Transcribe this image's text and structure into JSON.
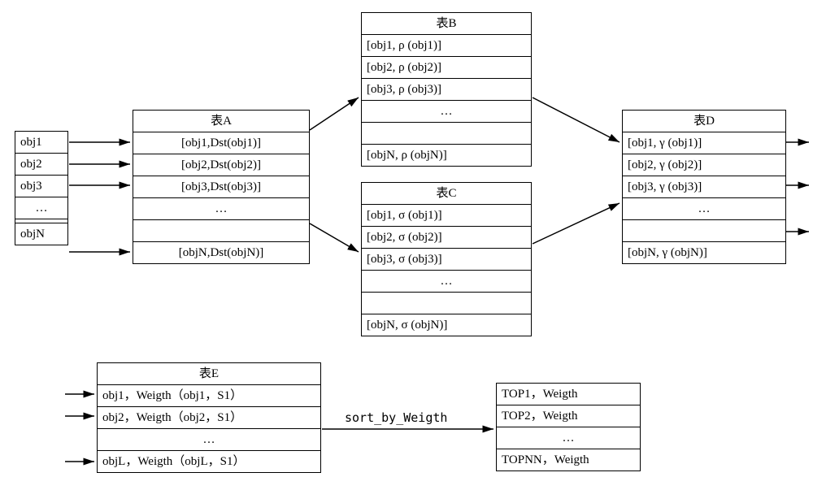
{
  "input": {
    "rows": [
      "obj1",
      "obj2",
      "obj3",
      "…",
      "",
      "objN"
    ]
  },
  "tableA": {
    "title": "表A",
    "rows": [
      "[obj1,Dst(obj1)]",
      "[obj2,Dst(obj2)]",
      "[obj3,Dst(obj3)]",
      "…",
      "",
      "[objN,Dst(objN)]"
    ]
  },
  "tableB": {
    "title": "表B",
    "rows": [
      "[obj1, ρ (obj1)]",
      "[obj2, ρ (obj2)]",
      "[obj3, ρ (obj3)]",
      "…",
      "",
      "[objN, ρ (objN)]"
    ]
  },
  "tableC": {
    "title": "表C",
    "rows": [
      "[obj1, σ (obj1)]",
      "[obj2, σ (obj2)]",
      "[obj3, σ (obj3)]",
      "…",
      "",
      "[objN, σ (objN)]"
    ]
  },
  "tableD": {
    "title": "表D",
    "rows": [
      "[obj1, γ (obj1)]",
      "[obj2, γ (obj2)]",
      "[obj3, γ (obj3)]",
      "…",
      "",
      "[objN, γ (objN)]"
    ]
  },
  "tableE": {
    "title": "表E",
    "rows": [
      "obj1，Weigth（obj1，S1）",
      "obj2，Weigth（obj2，S1）",
      "…",
      "objL，Weigth（objL，S1）"
    ]
  },
  "tableTop": {
    "rows": [
      "TOP1，Weigth",
      "TOP2，Weigth",
      "…",
      "TOPNN，Weigth"
    ]
  },
  "sort_label": "sort_by_Weigth",
  "chart_data": {
    "type": "table",
    "description": "Data-flow diagram: input objects obj1..objN are mapped through tables A (Dst), B (ρ), C (σ), D (γ). Table E collects obj1..objL with Weigth(obj,S1), sorted by weight into TOP1..TOPNN output.",
    "nodes": [
      {
        "id": "input",
        "label": "obj1..objN"
      },
      {
        "id": "A",
        "label": "表A",
        "transform": "Dst"
      },
      {
        "id": "B",
        "label": "表B",
        "transform": "ρ"
      },
      {
        "id": "C",
        "label": "表C",
        "transform": "σ"
      },
      {
        "id": "D",
        "label": "表D",
        "transform": "γ"
      },
      {
        "id": "E",
        "label": "表E",
        "transform": "Weigth(_,S1)"
      },
      {
        "id": "TOP",
        "label": "TOP1..TOPNN"
      }
    ],
    "edges": [
      [
        "input",
        "A"
      ],
      [
        "A",
        "B"
      ],
      [
        "A",
        "C"
      ],
      [
        "B",
        "D"
      ],
      [
        "C",
        "D"
      ],
      [
        "D",
        "out"
      ],
      [
        "in",
        "E"
      ],
      [
        "E",
        "TOP",
        "sort_by_Weigth"
      ]
    ]
  }
}
